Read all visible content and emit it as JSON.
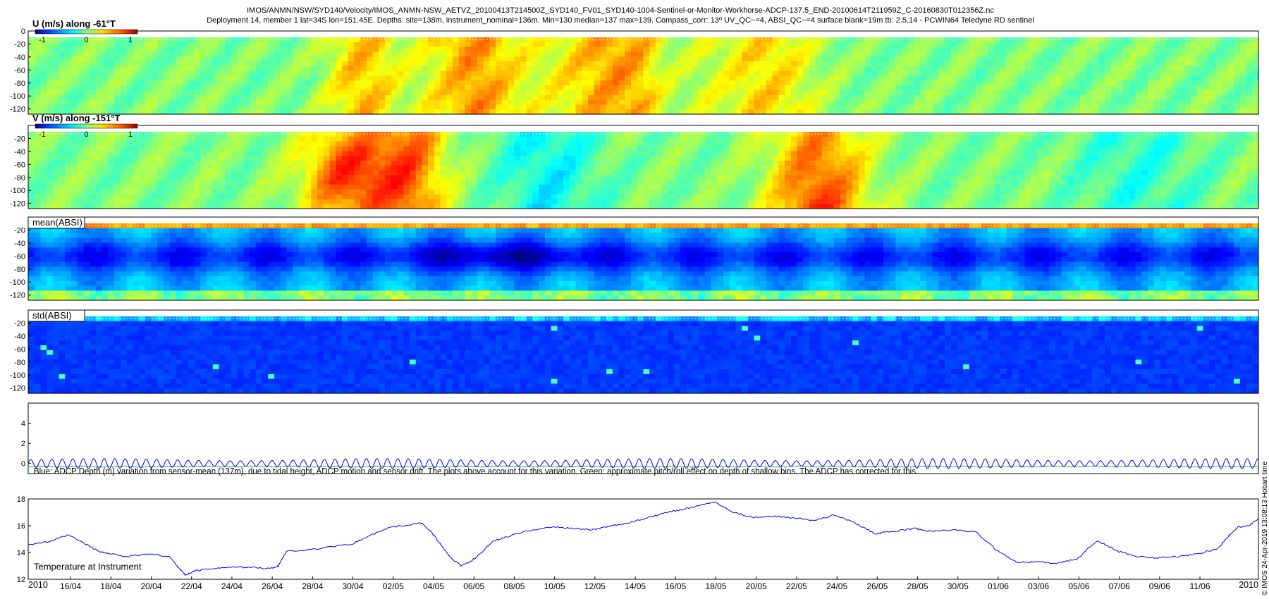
{
  "header": {
    "title_line1": "IMOS/ANMN/NSW/SYD140/Velocity/IMOS_ANMN-NSW_AETVZ_20100413T214500Z_SYD140_FV01_SYD140-1004-Sentinel-or-Monitor-Workhorse-ADCP-137.5_END-20100614T211959Z_C-20160830T012356Z.nc",
    "title_line2": "Deployment 14, member 1 lat=34S lon=151.45E. Depths: site=138m, instrument_nominal=136m. Min=130 median=137 max=139. Compass_corr: 13º UV_QC~=4, ABSI_QC~=4 surface blank=19m tb: 2.5.14 - PCWIN64 Teledyne RD sentinel"
  },
  "side_note": "© IMOS 24-Apr-2019 13:08:13 Hobart time",
  "colorbar": {
    "ticks": [
      "-1",
      "0",
      "1"
    ],
    "colors": [
      "#00008f",
      "#0050ff",
      "#00dfff",
      "#7fff7f",
      "#ffdf00",
      "#ff5000",
      "#8f0000"
    ]
  },
  "chart_data": [
    {
      "type": "heatmap",
      "title": "U (m/s) along -61°T",
      "depth_ticks": [
        "0",
        "-20",
        "-40",
        "-60",
        "-80",
        "-100",
        "-120"
      ],
      "ylim": [
        -128,
        0
      ],
      "colormap": "jet",
      "clim": [
        -1,
        1
      ]
    },
    {
      "type": "heatmap",
      "title": "V (m/s) along -151°T",
      "depth_ticks": [
        "-20",
        "-40",
        "-60",
        "-80",
        "-100",
        "-120"
      ],
      "ylim": [
        -128,
        0
      ],
      "colormap": "jet",
      "clim": [
        -1,
        1
      ]
    },
    {
      "type": "heatmap",
      "title": "mean(ABSI)",
      "depth_ticks": [
        "-20",
        "-40",
        "-60",
        "-80",
        "-100",
        "-120"
      ],
      "ylim": [
        -128,
        0
      ],
      "colormap": "jet"
    },
    {
      "type": "heatmap",
      "title": "std(ABSI)",
      "depth_ticks": [
        "-20",
        "-40",
        "-60",
        "-80",
        "-100",
        "-120"
      ],
      "ylim": [
        -128,
        0
      ],
      "colormap": "jet"
    },
    {
      "type": "line",
      "ticks": [
        "0",
        "2",
        "4"
      ],
      "ylim": [
        -1,
        6
      ],
      "annotation": "Blue: ADCP Depth (m) variation from sensor-mean (137m), due to tidal height, ADCP motion and sensor drift. The plots above account for this variation. Green: approximate pitch/roll effect on depth of shallow bins. The ADCP has corrected for this.",
      "tidal_amplitude_m": 0.45,
      "tidal_period_days": 0.52,
      "x_range_days": [
        0,
        61
      ],
      "series": [
        {
          "color": "#0000ff",
          "style": "tidal oscillation"
        },
        {
          "color": "#00a000",
          "style": "pitch/roll effect"
        }
      ]
    },
    {
      "type": "line",
      "label": "Temperature at Instrument",
      "ticks": [
        "12",
        "14",
        "16",
        "18"
      ],
      "ylim": [
        12,
        18
      ],
      "x_range_days": [
        0,
        61
      ],
      "series": [
        {
          "color": "#0000ff",
          "x_days": [
            0,
            1,
            2,
            3,
            3.5,
            4,
            5,
            6,
            7,
            7.5,
            7.8,
            8.2,
            9,
            10,
            11,
            12,
            12.4,
            12.8,
            14,
            16,
            17,
            18,
            19.5,
            20,
            20.5,
            21,
            21.5,
            22,
            22.5,
            23,
            24,
            25,
            26,
            27,
            28,
            29,
            30,
            31,
            32,
            33,
            34,
            35,
            36,
            37,
            38,
            39,
            40,
            41,
            42,
            43,
            44,
            44.5,
            45,
            46,
            47,
            48,
            49,
            50,
            51,
            52,
            53,
            54,
            55,
            56,
            57,
            58,
            59,
            59.5,
            60,
            60.5,
            61
          ],
          "temp": [
            14.6,
            14.8,
            15.3,
            14.5,
            14.1,
            13.9,
            13.7,
            13.9,
            13.7,
            12.8,
            12.3,
            12.6,
            12.8,
            12.9,
            12.9,
            12.8,
            13.0,
            14.1,
            14.2,
            14.6,
            15.3,
            15.9,
            16.2,
            15.5,
            14.5,
            13.5,
            13.0,
            13.4,
            14.0,
            14.8,
            15.3,
            15.7,
            15.9,
            15.8,
            15.7,
            16.0,
            16.3,
            16.7,
            17.1,
            17.4,
            17.8,
            17.0,
            16.6,
            16.7,
            16.6,
            16.4,
            16.8,
            16.2,
            15.4,
            15.6,
            15.8,
            15.6,
            15.6,
            15.7,
            15.5,
            14.2,
            13.3,
            13.3,
            13.2,
            13.5,
            14.9,
            14.1,
            13.7,
            13.6,
            13.7,
            13.9,
            14.3,
            15.2,
            15.9,
            16.0,
            16.5
          ]
        }
      ]
    }
  ],
  "x_axis": {
    "year_left": "2010",
    "year_right": "2010",
    "ticks": [
      "16/04",
      "18/04",
      "20/04",
      "22/04",
      "24/04",
      "26/04",
      "28/04",
      "30/04",
      "02/05",
      "04/05",
      "06/05",
      "08/05",
      "10/05",
      "12/05",
      "14/05",
      "16/05",
      "18/05",
      "20/05",
      "22/05",
      "24/05",
      "26/05",
      "28/05",
      "30/05",
      "01/06",
      "03/06",
      "05/06",
      "07/06",
      "09/06",
      "11/06"
    ]
  }
}
